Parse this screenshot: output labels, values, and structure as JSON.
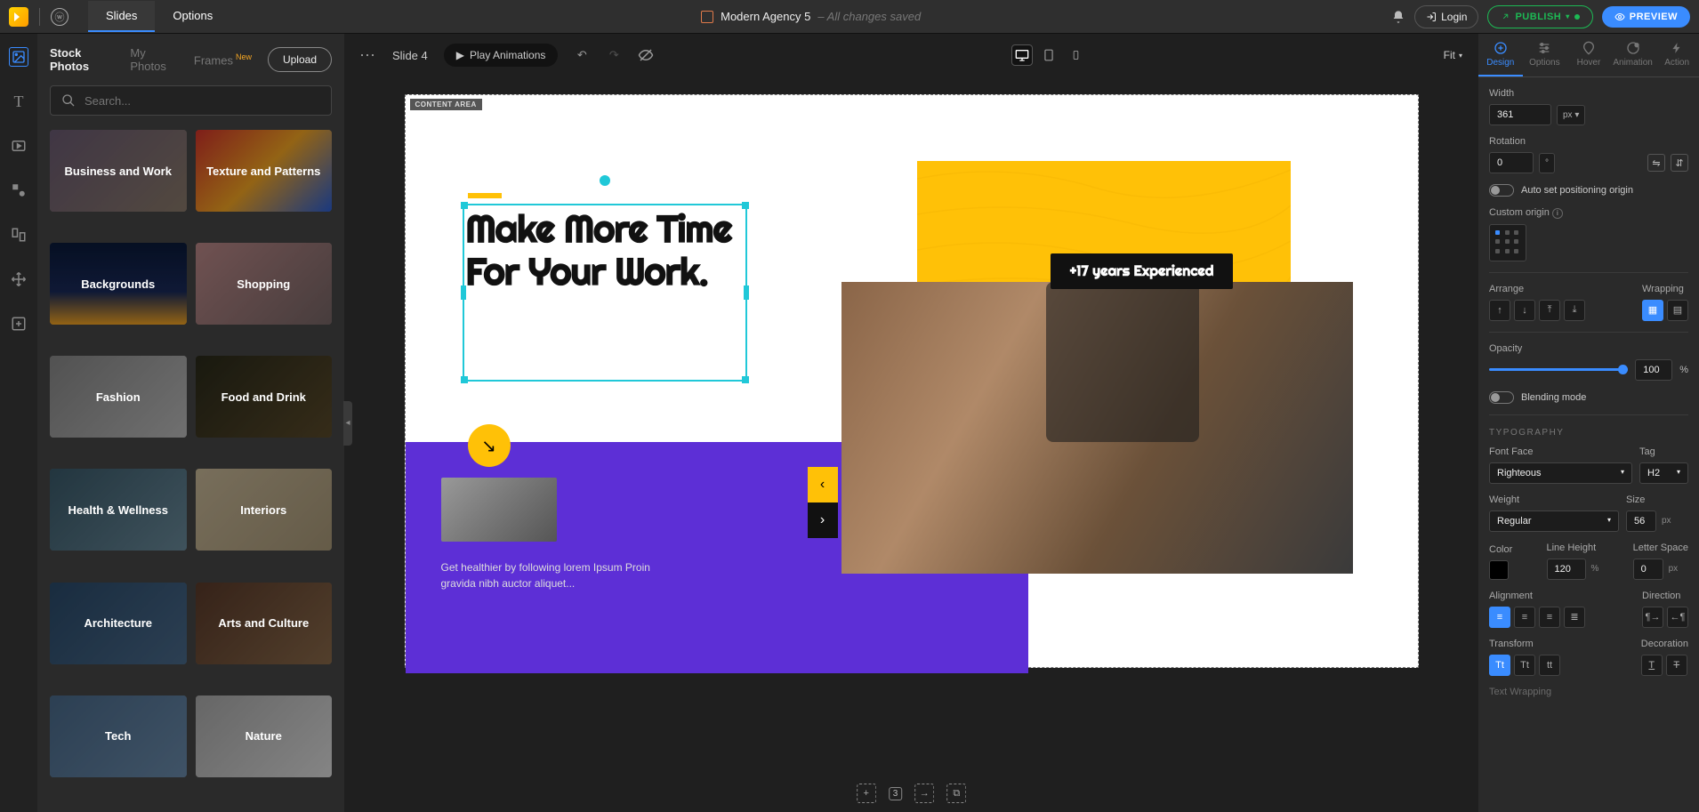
{
  "topbar": {
    "tabs": [
      "Slides",
      "Options"
    ],
    "active_tab": 0,
    "doc_title": "Modern Agency 5",
    "save_status": "– All changes saved",
    "login": "Login",
    "publish": "PUBLISH",
    "preview": "PREVIEW"
  },
  "left_panel": {
    "tabs": [
      {
        "label": "Stock Photos",
        "badge": null
      },
      {
        "label": "My Photos",
        "badge": null
      },
      {
        "label": "Frames",
        "badge": "New"
      }
    ],
    "active_tab": 0,
    "upload": "Upload",
    "search_placeholder": "Search...",
    "categories": [
      {
        "label": "Business and Work",
        "bg": "linear-gradient(135deg,#6b5b73,#8a7a6b)"
      },
      {
        "label": "Texture and Patterns",
        "bg": "linear-gradient(135deg,#d4332b,#f5a623,#2b5fd4)"
      },
      {
        "label": "Backgrounds",
        "bg": "linear-gradient(180deg,#0a1a3a 0%,#1a2a5a 60%,#f5a623 100%)"
      },
      {
        "label": "Shopping",
        "bg": "linear-gradient(135deg,#b88,#766)"
      },
      {
        "label": "Fashion",
        "bg": "linear-gradient(135deg,#888,#bbb)"
      },
      {
        "label": "Food and Drink",
        "bg": "linear-gradient(135deg,#2a2a1a,#5a4a2a)"
      },
      {
        "label": "Health & Wellness",
        "bg": "linear-gradient(135deg,#3a5a6a,#6a8a9a)"
      },
      {
        "label": "Interiors",
        "bg": "linear-gradient(135deg,#c8b898,#a89878)"
      },
      {
        "label": "Architecture",
        "bg": "linear-gradient(135deg,#2a4a6a,#4a6a8a)"
      },
      {
        "label": "Arts and Culture",
        "bg": "linear-gradient(135deg,#5a3a2a,#8a6a4a)"
      },
      {
        "label": "Tech",
        "bg": "linear-gradient(135deg,#4a6a8a,#6a8aaa)"
      },
      {
        "label": "Nature",
        "bg": "linear-gradient(135deg,#aaa,#ddd)"
      }
    ]
  },
  "canvas_toolbar": {
    "slide_label": "Slide 4",
    "play_anim": "Play Animations",
    "fit": "Fit"
  },
  "slide": {
    "content_area_label": "CONTENT AREA",
    "heading": "Make More Time For Your Work.",
    "experience_badge": "+17 years Experienced",
    "caption": "Get healthier by following lorem Ipsum Proin gravida nibh auctor aliquet..."
  },
  "right_panel": {
    "tabs": [
      "Design",
      "Options",
      "Hover",
      "Animation",
      "Action"
    ],
    "active_tab": 0,
    "width": {
      "label": "Width",
      "value": "361",
      "unit": "px"
    },
    "rotation": {
      "label": "Rotation",
      "value": "0"
    },
    "auto_origin": "Auto set positioning origin",
    "custom_origin": "Custom origin",
    "arrange": "Arrange",
    "wrapping": "Wrapping",
    "opacity": {
      "label": "Opacity",
      "value": "100",
      "unit": "%"
    },
    "blending": "Blending mode",
    "typography_section": "TYPOGRAPHY",
    "font_face": {
      "label": "Font Face",
      "value": "Righteous"
    },
    "tag": {
      "label": "Tag",
      "value": "H2"
    },
    "weight": {
      "label": "Weight",
      "value": "Regular"
    },
    "size": {
      "label": "Size",
      "value": "56",
      "unit": "px"
    },
    "color": "Color",
    "line_height": {
      "label": "Line Height",
      "value": "120",
      "unit": "%"
    },
    "letter_space": {
      "label": "Letter Space",
      "value": "0",
      "unit": "px"
    },
    "alignment": "Alignment",
    "direction": "Direction",
    "transform": "Transform",
    "decoration": "Decoration",
    "text_wrapping": "Text Wrapping"
  },
  "bottom_tools": {
    "count": "3"
  }
}
